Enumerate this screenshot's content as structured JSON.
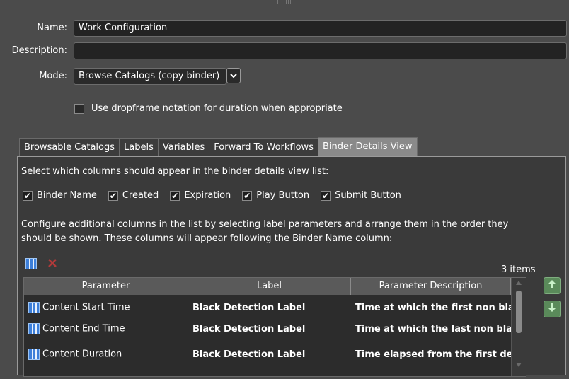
{
  "form": {
    "name_label": "Name:",
    "name_value": "Work Configuration",
    "description_label": "Description:",
    "description_value": "",
    "mode_label": "Mode:",
    "mode_value": "Browse Catalogs (copy binder)",
    "dropframe_label": "Use dropframe notation for duration when appropriate",
    "dropframe_checked": false
  },
  "tabs": [
    {
      "label": "Browsable Catalogs",
      "active": false
    },
    {
      "label": "Labels",
      "active": false
    },
    {
      "label": "Variables",
      "active": false
    },
    {
      "label": "Forward To Workflows",
      "active": false
    },
    {
      "label": "Binder Details View",
      "active": true
    }
  ],
  "panel": {
    "select_columns_text": "Select which columns should appear in the binder details view list:",
    "columns": [
      {
        "label": "Binder Name",
        "checked": true
      },
      {
        "label": "Created",
        "checked": true
      },
      {
        "label": "Expiration",
        "checked": true
      },
      {
        "label": "Play Button",
        "checked": true
      },
      {
        "label": "Submit Button",
        "checked": true
      }
    ],
    "configure_text_1": "Configure additional columns in the list by selecting label parameters and arrange them in the order they",
    "configure_text_2": "should be shown. These columns will appear following the Binder Name column:",
    "item_count": "3 items",
    "grid": {
      "headers": [
        "Parameter",
        "Label",
        "Parameter Description"
      ],
      "rows": [
        {
          "parameter": "Content Start Time",
          "label": "Black Detection Label",
          "description": "Time at which the first non bla..."
        },
        {
          "parameter": "Content End Time",
          "label": "Black Detection Label",
          "description": "Time at which the last non blac..."
        },
        {
          "parameter": "Content Duration",
          "label": "Black Detection Label",
          "description": "Time elapsed from the first det..."
        }
      ]
    }
  },
  "colors": {
    "background": "#4b4b4b",
    "panel": "#3a3a3a",
    "input": "#232323",
    "active_tab": "#8a8a8a",
    "accent_blue": "#3d7fd9",
    "delete_red": "#c0392b",
    "move_green": "#5a8a5a"
  },
  "icons": {
    "add_parameter": "add-columns-icon",
    "delete": "delete-x-icon",
    "move_up": "arrow-up-icon",
    "move_down": "arrow-down-icon",
    "row_param": "parameter-icon"
  }
}
